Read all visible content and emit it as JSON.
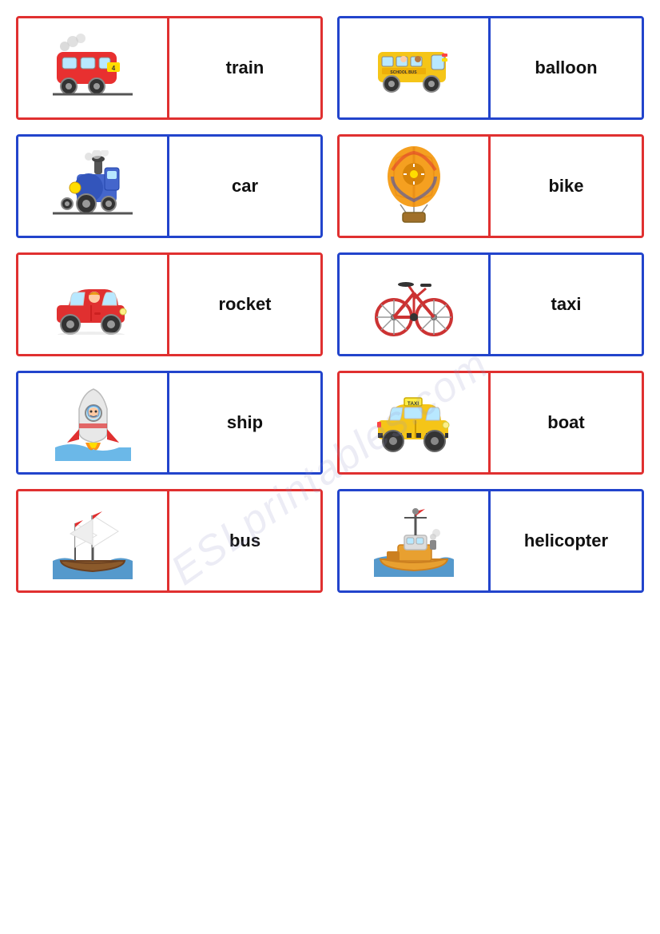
{
  "watermark": "ESLprintables.com",
  "cards": [
    {
      "id": "train-card",
      "border": "red-border",
      "label": "train",
      "emoji": "🚂",
      "position": "left"
    },
    {
      "id": "balloon-card",
      "border": "blue-border",
      "label": "balloon",
      "emoji": "🚌",
      "position": "right"
    },
    {
      "id": "car-card",
      "border": "blue-border",
      "label": "car",
      "emoji": "🚃",
      "position": "left"
    },
    {
      "id": "bike-card",
      "border": "red-border",
      "label": "bike",
      "emoji": "🎈",
      "position": "right"
    },
    {
      "id": "rocket-card",
      "border": "red-border",
      "label": "rocket",
      "emoji": "🚗",
      "position": "left"
    },
    {
      "id": "taxi-card",
      "border": "blue-border",
      "label": "taxi",
      "emoji": "🚲",
      "position": "right"
    },
    {
      "id": "ship-card",
      "border": "blue-border",
      "label": "ship",
      "emoji": "🚀",
      "position": "left"
    },
    {
      "id": "boat-card",
      "border": "red-border",
      "label": "boat",
      "emoji": "🚕",
      "position": "right"
    },
    {
      "id": "bus-card",
      "border": "red-border",
      "label": "bus",
      "emoji": "⛵",
      "position": "left"
    },
    {
      "id": "helicopter-card",
      "border": "blue-border",
      "label": "helicopter",
      "emoji": "🚢",
      "position": "right"
    }
  ]
}
